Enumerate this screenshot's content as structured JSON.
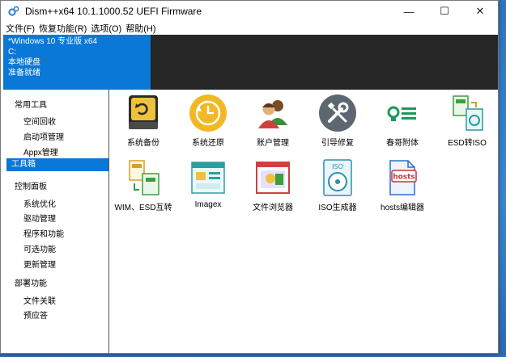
{
  "window": {
    "title": "Dism++x64 10.1.1000.52 UEFI Firmware",
    "controls": [
      "—",
      "☐",
      "✕"
    ]
  },
  "menu": [
    "文件(F)",
    "恢复功能(R)",
    "选项(O)",
    "帮助(H)"
  ],
  "session": {
    "line1": "*Windows 10 专业版 x64",
    "line2": "C:",
    "line3": "本地硬盘",
    "line4": "准备就绪"
  },
  "sidebar": {
    "group1": "常用工具",
    "items1": [
      "空间回收",
      "启动项管理",
      "Appx管理",
      "工具箱"
    ],
    "group2": "控制面板",
    "items2": [
      "系统优化",
      "驱动管理",
      "程序和功能",
      "可选功能",
      "更新管理"
    ],
    "group3": "部署功能",
    "items3": [
      "文件关联",
      "预应答"
    ]
  },
  "tools": [
    {
      "label": "系统备份",
      "icon": "backup-drive-icon"
    },
    {
      "label": "系统还原",
      "icon": "restore-clock-icon"
    },
    {
      "label": "账户管理",
      "icon": "users-icon"
    },
    {
      "label": "引导修复",
      "icon": "wrench-screwdriver-icon"
    },
    {
      "label": "春哥附体",
      "icon": "key-lines-icon"
    },
    {
      "label": "ESD转ISO",
      "icon": "esd-iso-icon"
    },
    {
      "label": "WIM、ESD互转",
      "icon": "wim-esd-icon"
    },
    {
      "label": "Imagex",
      "icon": "imagex-window-icon"
    },
    {
      "label": "文件浏览器",
      "icon": "file-browser-icon"
    },
    {
      "label": "ISO生成器",
      "icon": "iso-disc-icon"
    },
    {
      "label": "hosts编辑器",
      "icon": "hosts-file-icon"
    }
  ],
  "colors": {
    "accent": "#0a78d7",
    "session_dark": "#262626",
    "desktop": "#3b7fc4"
  }
}
